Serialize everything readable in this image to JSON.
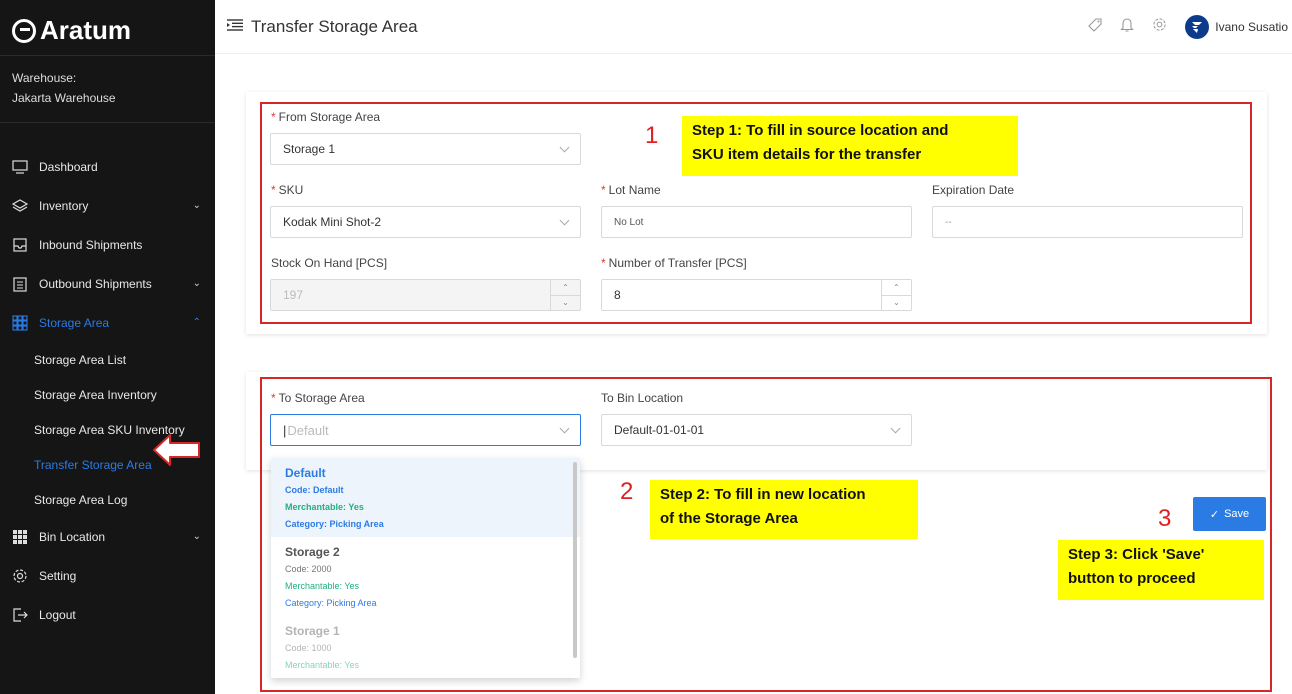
{
  "brand": {
    "name": "Aratum"
  },
  "warehouse": {
    "label": "Warehouse:",
    "value": "Jakarta Warehouse"
  },
  "sidebar": {
    "items": [
      {
        "label": "Dashboard",
        "icon": "monitor-icon"
      },
      {
        "label": "Inventory",
        "icon": "layers-icon"
      },
      {
        "label": "Inbound Shipments",
        "icon": "inbox-icon"
      },
      {
        "label": "Outbound Shipments",
        "icon": "clipboard-icon"
      },
      {
        "label": "Storage Area",
        "icon": "grid-icon"
      },
      {
        "label": "Bin Location",
        "icon": "apps-icon"
      },
      {
        "label": "Setting",
        "icon": "gear-icon"
      },
      {
        "label": "Logout",
        "icon": "logout-icon"
      }
    ],
    "storage_sub": [
      "Storage Area List",
      "Storage Area Inventory",
      "Storage Area SKU Inventory",
      "Transfer Storage Area",
      "Storage Area Log"
    ]
  },
  "header": {
    "title": "Transfer Storage Area",
    "user": "Ivano Susatio"
  },
  "form1": {
    "from_label": "From Storage Area",
    "from_value": "Storage 1",
    "sku_label": "SKU",
    "sku_value": "Kodak Mini Shot-2",
    "lot_label": "Lot Name",
    "lot_value": "No Lot",
    "exp_label": "Expiration Date",
    "exp_value": "--",
    "stock_label": "Stock On Hand [PCS]",
    "stock_value": "197",
    "transfer_label": "Number of Transfer [PCS]",
    "transfer_value": "8"
  },
  "form2": {
    "to_label": "To Storage Area",
    "to_placeholder": "Default",
    "bin_label": "To Bin Location",
    "bin_value": "Default-01-01-01"
  },
  "dropdown": [
    {
      "name": "Default",
      "code": "Code: Default",
      "merch": "Merchantable: Yes",
      "cat": "Category: Picking Area"
    },
    {
      "name": "Storage 2",
      "code": "Code: 2000",
      "merch": "Merchantable: Yes",
      "cat": "Category: Picking Area"
    },
    {
      "name": "Storage 1",
      "code": "Code: 1000",
      "merch": "Merchantable: Yes"
    }
  ],
  "save_label": "Save",
  "annotations": {
    "n1": "1",
    "s1a": "Step 1: To fill in source location and",
    "s1b": "SKU item details for the transfer",
    "n2": "2",
    "s2a": "Step 2: To fill in new location",
    "s2b": "of the Storage Area",
    "n3": "3",
    "s3a": "Step 3: Click 'Save'",
    "s3b": "button to proceed"
  },
  "colors": {
    "accent": "#2b7be5",
    "sidebar_bg": "#151515",
    "annotation_red": "#d62728",
    "highlight": "#ffff00"
  }
}
